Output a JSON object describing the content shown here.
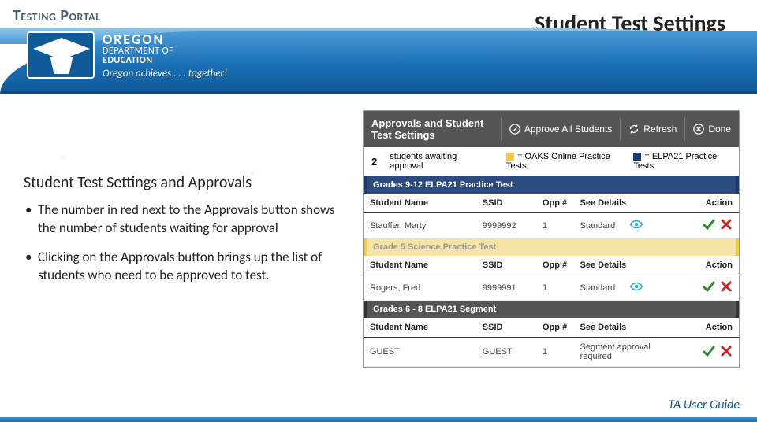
{
  "header": {
    "portal_label": "Testing Portal"
  },
  "slide": {
    "title": "Student Test Settings"
  },
  "logo": {
    "line1": "OREGON",
    "line2_a": "DEPARTMENT OF",
    "line2_b": "EDUCATION",
    "tagline": "Oregon achieves . . . together!"
  },
  "body": {
    "heading": "Student Test Settings and Approvals",
    "bullets": [
      "The number in red next to the Approvals button shows the number of students waiting for approval",
      "Clicking on the Approvals button brings up the list of students who need to be approved to test."
    ]
  },
  "screenshot": {
    "title": "Approvals and Student Test Settings",
    "buttons": {
      "approve_all": "Approve All Students",
      "refresh": "Refresh",
      "done": "Done"
    },
    "legend": {
      "count": "2",
      "count_label": "students awaiting approval",
      "yellow": "= OAKS Online Practice Tests",
      "navy": "= ELPA21 Practice Tests"
    },
    "columns": {
      "name": "Student Name",
      "ssid": "SSID",
      "opp": "Opp #",
      "details": "See Details",
      "action": "Action"
    },
    "sections": [
      {
        "label": "Grades 9-12 ELPA21 Practice Test",
        "style": "navy",
        "rows": [
          {
            "name": "Stauffer, Marty",
            "ssid": "9999992",
            "opp": "1",
            "details": "Standard",
            "has_eye": true,
            "has_approve": true,
            "has_reject": true
          }
        ]
      },
      {
        "label": "Grade 5 Science Practice Test",
        "style": "yellow",
        "rows": [
          {
            "name": "Rogers, Fred",
            "ssid": "9999991",
            "opp": "1",
            "details": "Standard",
            "has_eye": true,
            "has_approve": true,
            "has_reject": true
          }
        ]
      },
      {
        "label": "Grades 6 - 8 ELPA21 Segment",
        "style": "gray",
        "rows": [
          {
            "name": "GUEST",
            "ssid": "GUEST",
            "opp": "1",
            "details": "Segment approval required",
            "has_eye": false,
            "has_approve": true,
            "has_reject": true
          }
        ]
      }
    ]
  },
  "footer": {
    "link": "TA User Guide"
  }
}
